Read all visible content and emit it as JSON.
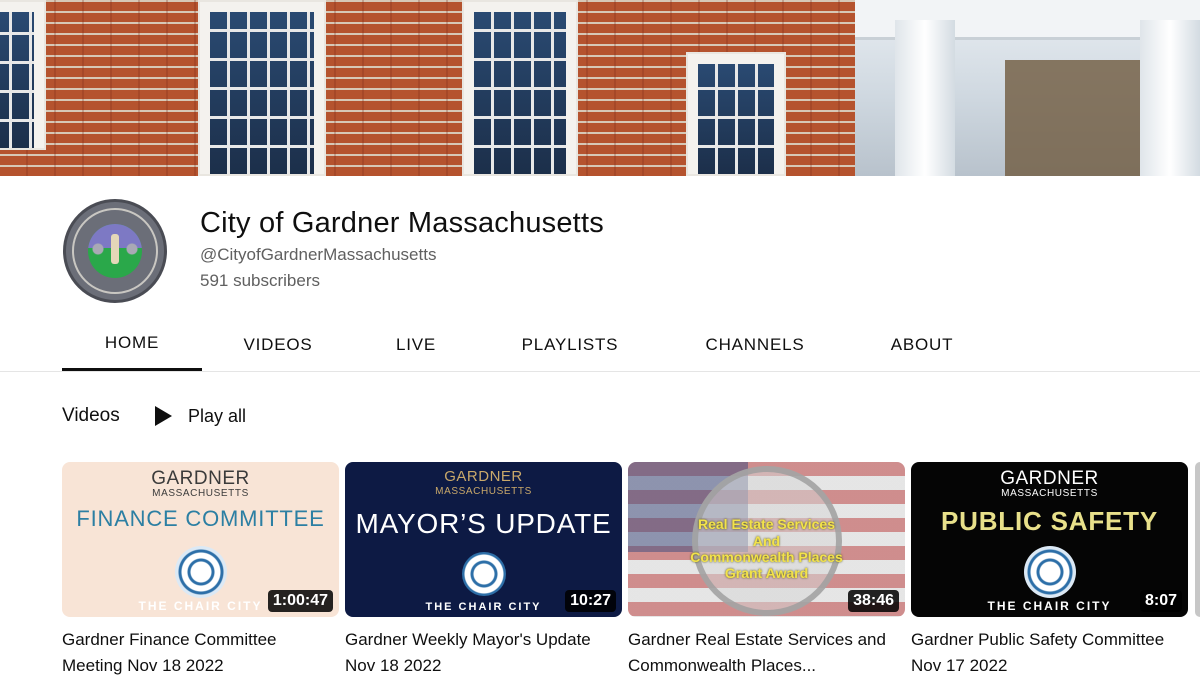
{
  "channel": {
    "name": "City of Gardner Massachusetts",
    "handle": "@CityofGardnerMassachusetts",
    "subscribers": "591 subscribers"
  },
  "tabs": [
    {
      "label": "HOME",
      "active": true
    },
    {
      "label": "VIDEOS",
      "active": false
    },
    {
      "label": "LIVE",
      "active": false
    },
    {
      "label": "PLAYLISTS",
      "active": false
    },
    {
      "label": "CHANNELS",
      "active": false
    },
    {
      "label": "ABOUT",
      "active": false
    }
  ],
  "section": {
    "title": "Videos",
    "play_all": "Play all"
  },
  "videos": [
    {
      "title": "Gardner Finance Committee Meeting Nov 18 2022",
      "duration": "1:00:47",
      "thumb": {
        "line1": "GARDNER",
        "line2": "MASSACHUSETTS",
        "big": "FINANCE COMMITTEE",
        "foot": "THE CHAIR CITY"
      }
    },
    {
      "title": "Gardner Weekly Mayor's Update Nov 18 2022",
      "duration": "10:27",
      "thumb": {
        "line1": "GARDNER",
        "line2": "MASSACHUSETTS",
        "big": "MAYOR’S UPDATE",
        "foot": "THE CHAIR CITY"
      }
    },
    {
      "title": "Gardner Real Estate Services and Commonwealth Places...",
      "duration": "38:46",
      "thumb": {
        "line1": "Real Estate Services",
        "line2": "And",
        "line3": "Commonwealth Places",
        "line4": "Grant Award"
      }
    },
    {
      "title": "Gardner Public Safety Committee Nov 17 2022",
      "duration": "8:07",
      "thumb": {
        "line1": "GARDNER",
        "line2": "MASSACHUSETTS",
        "big": "PUBLIC SAFETY",
        "foot": "THE CHAIR CITY"
      }
    }
  ],
  "colors": {
    "text_primary": "#0f0f0f",
    "text_secondary": "#606060",
    "divider": "#e5e5e5",
    "duration_badge": "#000000"
  }
}
